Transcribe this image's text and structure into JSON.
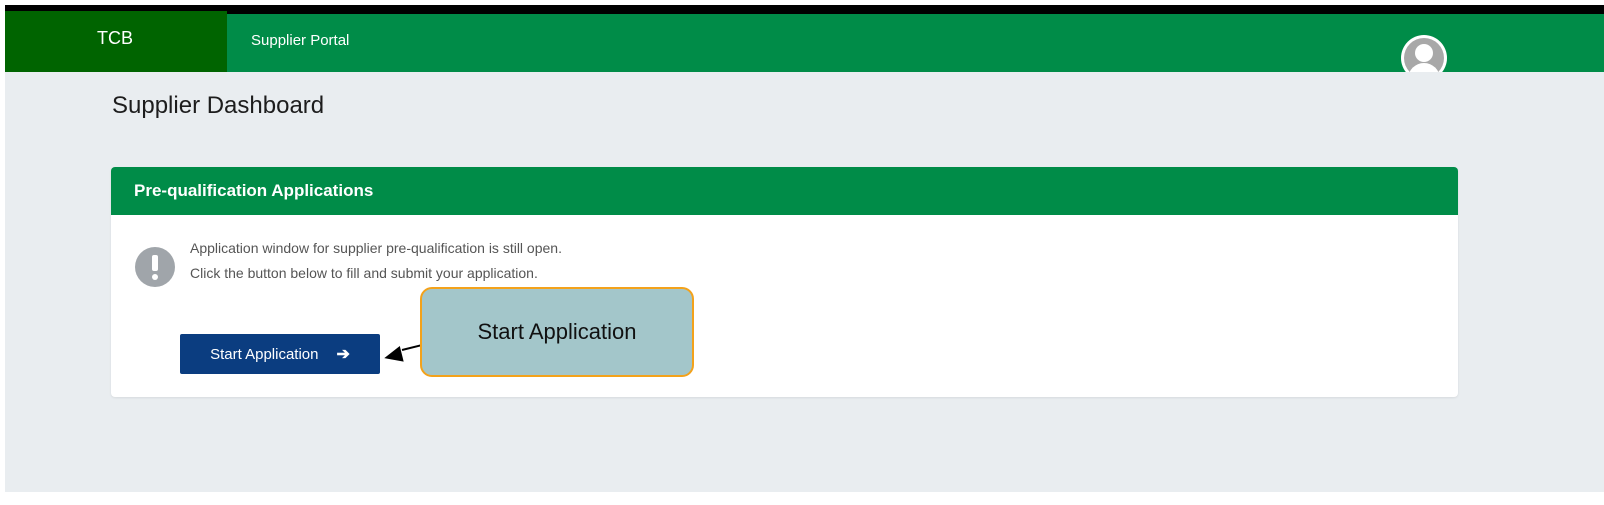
{
  "header": {
    "brand": "TCB",
    "portal_title": "Supplier Portal",
    "avatar_icon": "user-avatar-icon"
  },
  "page": {
    "title": "Supplier Dashboard"
  },
  "card": {
    "title": "Pre-qualification Applications",
    "info_icon": "exclamation-circle-icon",
    "message_line1": "Application window for supplier pre-qualification is still open.",
    "message_line2": "Click the button below to fill and submit your application.",
    "button_label": "Start Application",
    "button_icon": "arrow-right-icon"
  },
  "annotation": {
    "callout_text": "Start Application"
  },
  "colors": {
    "navbar": "#008c48",
    "brand_bg": "#006400",
    "button": "#0b3d80",
    "callout_bg": "#a3c6ca",
    "callout_border": "#f3a21b"
  }
}
